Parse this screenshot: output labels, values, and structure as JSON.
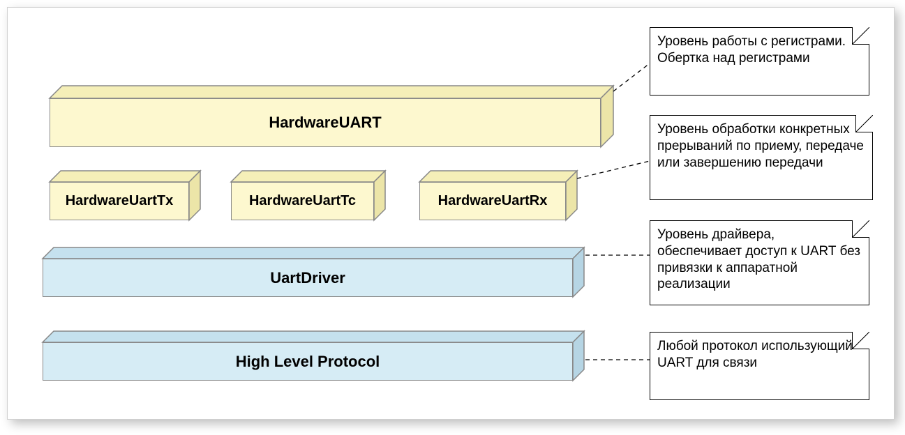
{
  "blocks": {
    "hardwareUart": "HardwareUART",
    "hardwareUartTx": "HardwareUartTx",
    "hardwareUartTc": "HardwareUartTc",
    "hardwareUartRx": "HardwareUartRx",
    "uartDriver": "UartDriver",
    "highLevelProtocol": "High Level Protocol"
  },
  "notes": {
    "n1": "Уровень работы с регистрами. Обертка над регистрами",
    "n2": "Уровень обработки конкретных прерываний по приему, передаче или завершению передачи",
    "n3": "Уровень драйвера, обеспечивает доступ к UART без привязки к аппаратной реализации",
    "n4": "Любой протокол использующий UART для связи"
  },
  "colors": {
    "yellowFront": "#fdf8cf",
    "blueFront": "#d6ecf5",
    "stroke": "#888888",
    "dash": "#000000"
  }
}
